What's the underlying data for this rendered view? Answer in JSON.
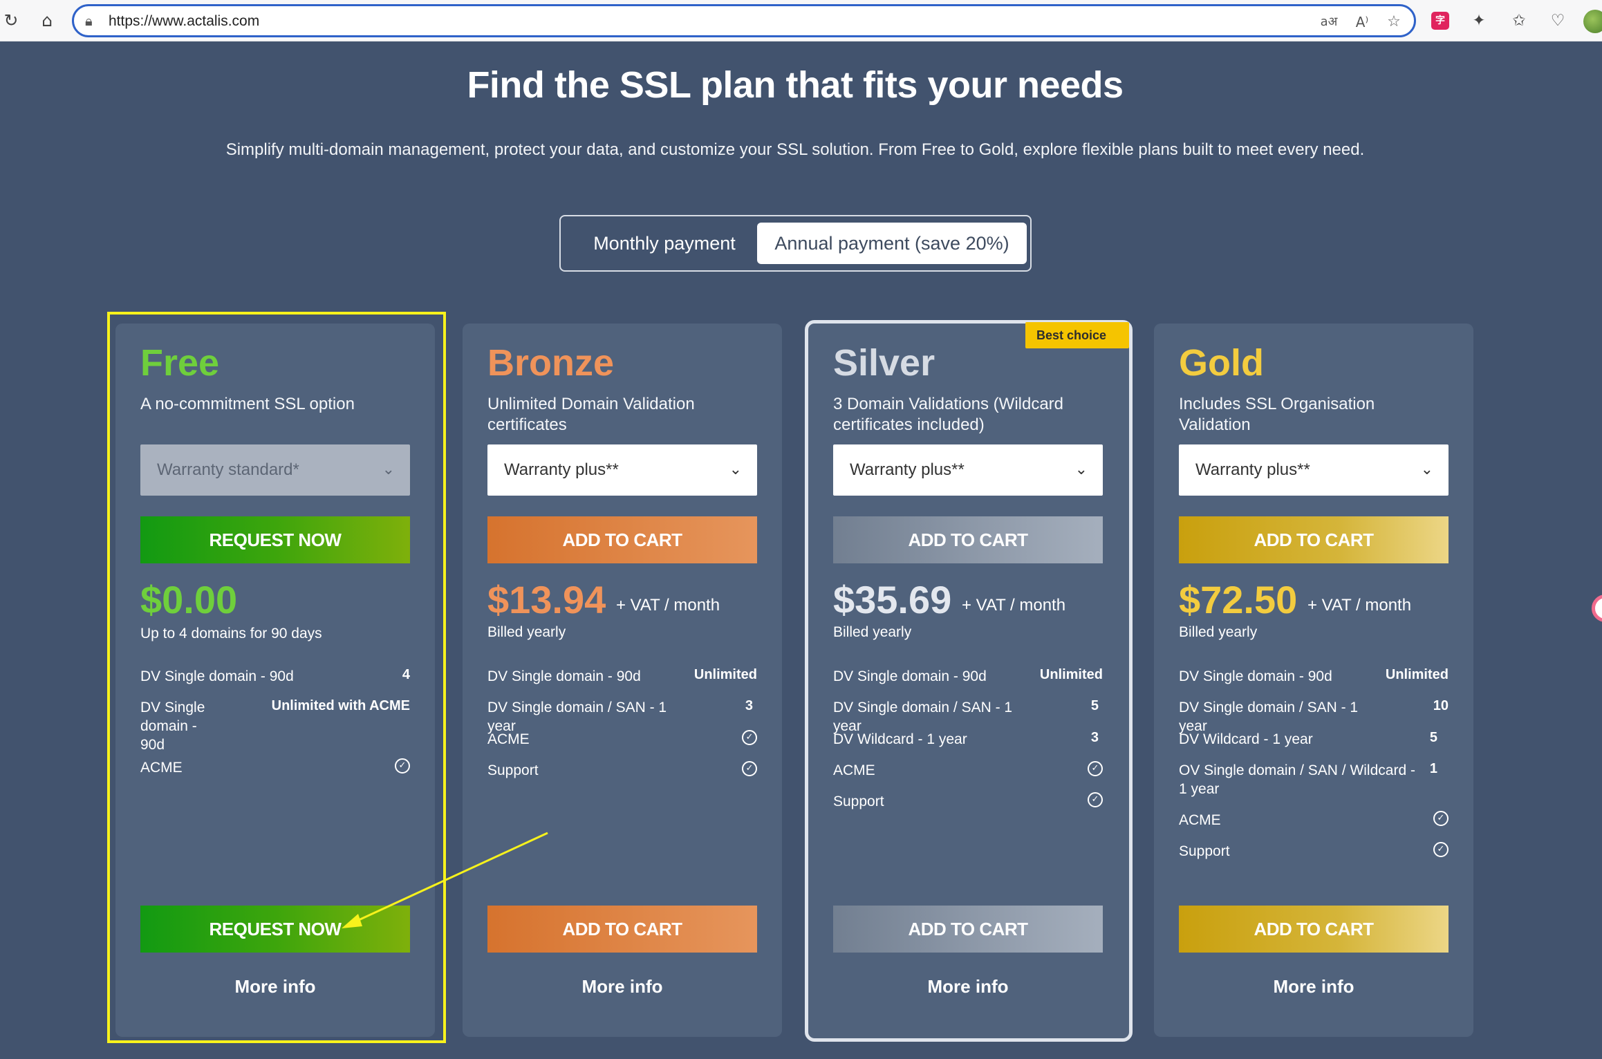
{
  "browser": {
    "url": "https://www.actalis.com",
    "icons": [
      "refresh-icon",
      "home-icon",
      "lock-icon",
      "translate-icon",
      "read-aloud-icon",
      "star-icon",
      "extension-icon",
      "puzzle-icon",
      "favorites-icon",
      "health-icon",
      "profile-avatar"
    ]
  },
  "header": {
    "title": "Find the SSL plan that fits your needs",
    "subtitle": "Simplify multi-domain management, protect your data, and customize your SSL solution. From Free to Gold, explore flexible plans built to meet every need."
  },
  "billing_toggle": {
    "monthly": "Monthly payment",
    "annual": "Annual payment (save 20%)",
    "selected": "annual"
  },
  "plans": [
    {
      "name": "Free",
      "color": "#6fcf3c",
      "description": "A no-commitment SSL option",
      "warranty": "Warranty standard*",
      "top_button": "REQUEST NOW",
      "price": "$0.00",
      "price_unit": "",
      "billed": "Up to 4 domains for 90 days",
      "features": [
        {
          "label": "DV Single domain - 90d",
          "value": "4"
        },
        {
          "label": "DV Single domain - 90d",
          "value": "Unlimited with ACME"
        },
        {
          "label": "ACME",
          "value": "check"
        }
      ],
      "bottom_button": "REQUEST NOW",
      "more": "More info"
    },
    {
      "name": "Bronze",
      "color": "#f0935a",
      "description": "Unlimited Domain Validation certificates",
      "warranty": "Warranty plus**",
      "top_button": "ADD TO CART",
      "price": "$13.94",
      "price_unit": "+ VAT / month",
      "billed": "Billed yearly",
      "features": [
        {
          "label": "DV Single domain - 90d",
          "value": "Unlimited"
        },
        {
          "label": "DV Single domain / SAN - 1 year",
          "value": "3"
        },
        {
          "label": "ACME",
          "value": "check"
        },
        {
          "label": "Support",
          "value": "check"
        }
      ],
      "bottom_button": "ADD TO CART",
      "more": "More info"
    },
    {
      "name": "Silver",
      "color": "#d6dbe3",
      "badge": "Best choice",
      "description": "3 Domain Validations (Wildcard certificates included)",
      "warranty": "Warranty plus**",
      "top_button": "ADD TO CART",
      "price": "$35.69",
      "price_unit": "+ VAT / month",
      "billed": "Billed yearly",
      "features": [
        {
          "label": "DV Single domain - 90d",
          "value": "Unlimited"
        },
        {
          "label": "DV Single domain / SAN - 1 year",
          "value": "5"
        },
        {
          "label": "DV Wildcard - 1 year",
          "value": "3"
        },
        {
          "label": "ACME",
          "value": "check"
        },
        {
          "label": "Support",
          "value": "check"
        }
      ],
      "bottom_button": "ADD TO CART",
      "more": "More info"
    },
    {
      "name": "Gold",
      "color": "#f3cc3f",
      "description": "Includes SSL Organisation Validation",
      "warranty": "Warranty plus**",
      "top_button": "ADD TO CART",
      "price": "$72.50",
      "price_unit": "+ VAT / month",
      "billed": "Billed yearly",
      "features": [
        {
          "label": "DV Single domain - 90d",
          "value": "Unlimited"
        },
        {
          "label": "DV Single domain / SAN - 1 year",
          "value": "10"
        },
        {
          "label": "DV Wildcard - 1 year",
          "value": "5"
        },
        {
          "label": "OV Single domain / SAN / Wildcard - 1 year",
          "value": "1"
        },
        {
          "label": "ACME",
          "value": "check"
        },
        {
          "label": "Support",
          "value": "check"
        }
      ],
      "bottom_button": "ADD TO CART",
      "more": "More info"
    }
  ],
  "annotation": {
    "highlight_color": "#f7f21c"
  }
}
